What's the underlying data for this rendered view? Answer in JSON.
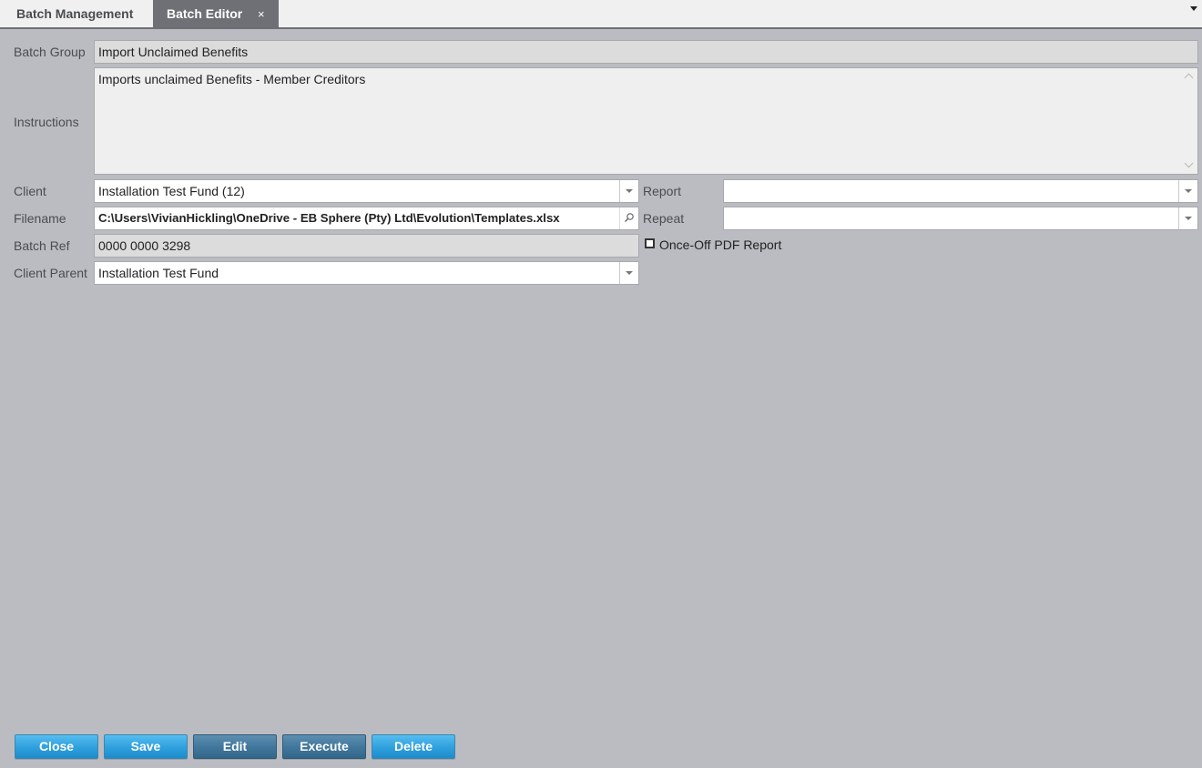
{
  "tabs": [
    {
      "label": "Batch Management",
      "active": false
    },
    {
      "label": "Batch Editor",
      "active": true,
      "close": "×"
    }
  ],
  "form": {
    "batch_group": {
      "label": "Batch Group",
      "value": "Import Unclaimed Benefits"
    },
    "instructions": {
      "label": "Instructions",
      "value": "Imports unclaimed Benefits - Member Creditors"
    },
    "client": {
      "label": "Client",
      "value": "Installation Test Fund (12)"
    },
    "filename": {
      "label": "Filename",
      "value": "C:\\Users\\VivianHickling\\OneDrive - EB Sphere (Pty) Ltd\\Evolution\\Templates.xlsx"
    },
    "batch_ref": {
      "label": "Batch Ref",
      "value": "0000 0000 3298"
    },
    "client_parent": {
      "label": "Client Parent",
      "value": "Installation Test Fund"
    },
    "report": {
      "label": "Report",
      "value": ""
    },
    "repeat": {
      "label": "Repeat",
      "value": ""
    },
    "once_off_pdf": {
      "label": "Once-Off PDF Report",
      "checked": false
    }
  },
  "buttons": {
    "close": "Close",
    "save": "Save",
    "edit": "Edit",
    "execute": "Execute",
    "delete": "Delete"
  },
  "icons": {
    "tab_close": "close-icon",
    "tab_menu": "chevron-down-icon",
    "dropdown": "chevron-down-icon",
    "search": "search-icon"
  },
  "colors": {
    "background": "#bbbcc1",
    "active_tab": "#6f7075",
    "button_primary": "#2f9fdd",
    "button_dark": "#40769b"
  }
}
